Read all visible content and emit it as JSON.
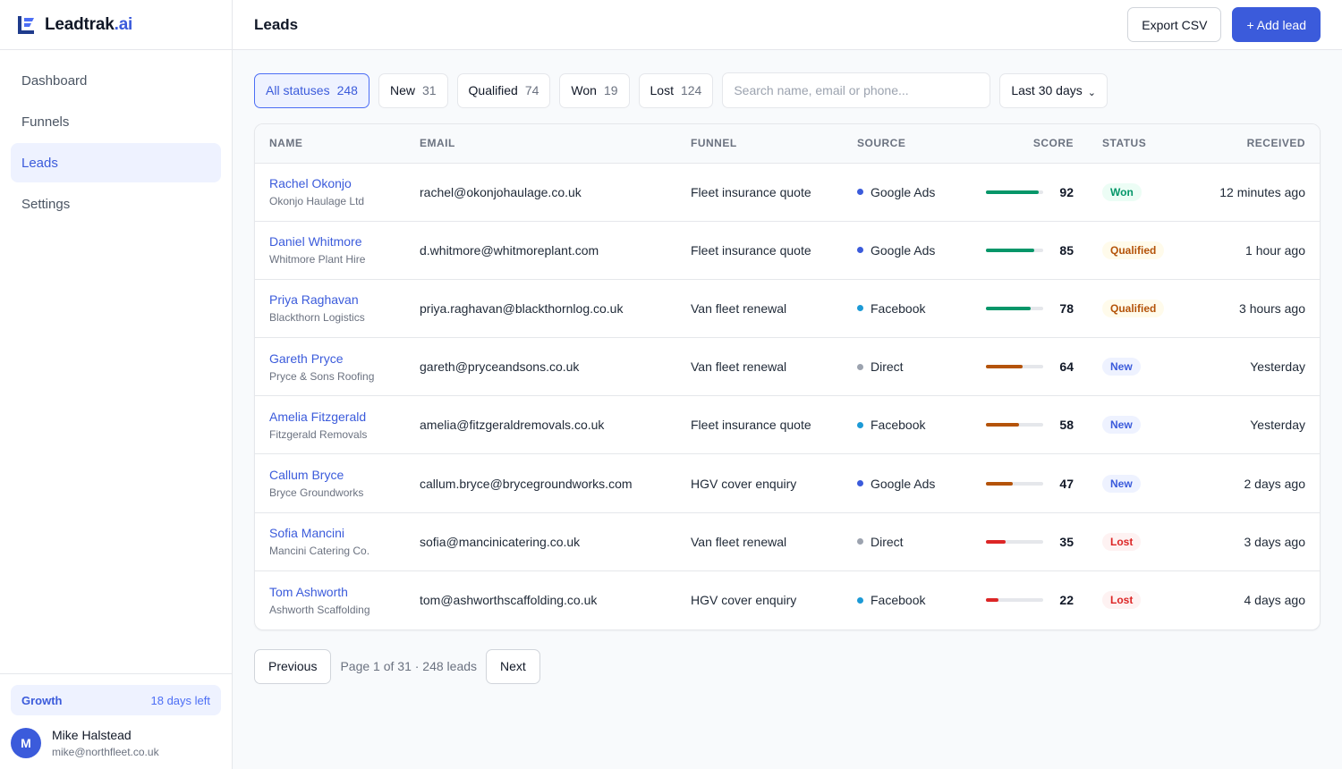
{
  "brand": {
    "name": "Leadtrak",
    "tld": ".ai",
    "accent": "#3b5bdb"
  },
  "nav": [
    {
      "label": "Dashboard",
      "active": false
    },
    {
      "label": "Funnels",
      "active": false
    },
    {
      "label": "Leads",
      "active": true
    },
    {
      "label": "Settings",
      "active": false
    }
  ],
  "plan": {
    "name": "Growth",
    "days_left": "18 days left"
  },
  "user": {
    "initial": "M",
    "name": "Mike Halstead",
    "email": "mike@northfleet.co.uk"
  },
  "header": {
    "title": "Leads",
    "export_label": "Export CSV",
    "add_label": "+ Add lead"
  },
  "filters": {
    "chips": [
      {
        "label": "All statuses",
        "count": "248",
        "active": true
      },
      {
        "label": "New",
        "count": "31",
        "active": false
      },
      {
        "label": "Qualified",
        "count": "74",
        "active": false
      },
      {
        "label": "Won",
        "count": "19",
        "active": false
      },
      {
        "label": "Lost",
        "count": "124",
        "active": false
      }
    ],
    "search_placeholder": "Search name, email or phone...",
    "range_label": "Last 30 days"
  },
  "table": {
    "columns": [
      "Name",
      "Email",
      "Funnel",
      "Source",
      "Score",
      "Status",
      "Received"
    ],
    "rows": [
      {
        "name": "Rachel Okonjo",
        "company": "Okonjo Haulage Ltd",
        "email": "rachel@okonjohaulage.co.uk",
        "funnel": "Fleet insurance quote",
        "source": "Google Ads",
        "score": 92,
        "status": "Won",
        "received": "12 minutes ago"
      },
      {
        "name": "Daniel Whitmore",
        "company": "Whitmore Plant Hire",
        "email": "d.whitmore@whitmoreplant.com",
        "funnel": "Fleet insurance quote",
        "source": "Google Ads",
        "score": 85,
        "status": "Qualified",
        "received": "1 hour ago"
      },
      {
        "name": "Priya Raghavan",
        "company": "Blackthorn Logistics",
        "email": "priya.raghavan@blackthornlog.co.uk",
        "funnel": "Van fleet renewal",
        "source": "Facebook",
        "score": 78,
        "status": "Qualified",
        "received": "3 hours ago"
      },
      {
        "name": "Gareth Pryce",
        "company": "Pryce & Sons Roofing",
        "email": "gareth@pryceandsons.co.uk",
        "funnel": "Van fleet renewal",
        "source": "Direct",
        "score": 64,
        "status": "New",
        "received": "Yesterday"
      },
      {
        "name": "Amelia Fitzgerald",
        "company": "Fitzgerald Removals",
        "email": "amelia@fitzgeraldremovals.co.uk",
        "funnel": "Fleet insurance quote",
        "source": "Facebook",
        "score": 58,
        "status": "New",
        "received": "Yesterday"
      },
      {
        "name": "Callum Bryce",
        "company": "Bryce Groundworks",
        "email": "callum.bryce@brycegroundworks.com",
        "funnel": "HGV cover enquiry",
        "source": "Google Ads",
        "score": 47,
        "status": "New",
        "received": "2 days ago"
      },
      {
        "name": "Sofia Mancini",
        "company": "Mancini Catering Co.",
        "email": "sofia@mancinicatering.co.uk",
        "funnel": "Van fleet renewal",
        "source": "Direct",
        "score": 35,
        "status": "Lost",
        "received": "3 days ago"
      },
      {
        "name": "Tom Ashworth",
        "company": "Ashworth Scaffolding",
        "email": "tom@ashworthscaffolding.co.uk",
        "funnel": "HGV cover enquiry",
        "source": "Facebook",
        "score": 22,
        "status": "Lost",
        "received": "4 days ago"
      }
    ]
  },
  "colors": {
    "source": {
      "Google Ads": "#3b5bdb",
      "Facebook": "#1c9ad6",
      "Direct": "#9ca3af"
    },
    "score_high": "#059669",
    "score_mid": "#b45309",
    "score_low": "#dc2626",
    "status": {
      "Won": {
        "bg": "#ecfdf5",
        "fg": "#059669"
      },
      "Qualified": {
        "bg": "#fffbeb",
        "fg": "#b45309"
      },
      "New": {
        "bg": "#eef2ff",
        "fg": "#3b5bdb"
      },
      "Lost": {
        "bg": "#fef2f2",
        "fg": "#dc2626"
      }
    }
  },
  "pagination": {
    "prev_label": "Previous",
    "info": "Page 1 of 31 · 248 leads",
    "next_label": "Next"
  }
}
